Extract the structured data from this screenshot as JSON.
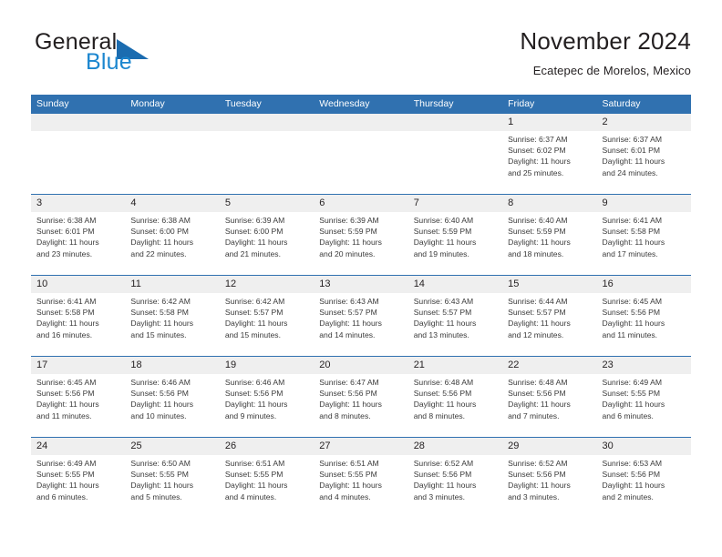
{
  "brand": {
    "general": "General",
    "blue": "Blue",
    "mark": "blue-triangle-logo"
  },
  "header": {
    "title": "November 2024",
    "subtitle": "Ecatepec de Morelos, Mexico"
  },
  "colors": {
    "header_blue": "#3071b0",
    "day_band_gray": "#efefef",
    "brand_blue": "#1b86cf",
    "text": "#231f20"
  },
  "weekdays": [
    "Sunday",
    "Monday",
    "Tuesday",
    "Wednesday",
    "Thursday",
    "Friday",
    "Saturday"
  ],
  "weeks": [
    [
      {
        "day": "",
        "sunrise": "",
        "sunset": "",
        "daylight1": "",
        "daylight2": ""
      },
      {
        "day": "",
        "sunrise": "",
        "sunset": "",
        "daylight1": "",
        "daylight2": ""
      },
      {
        "day": "",
        "sunrise": "",
        "sunset": "",
        "daylight1": "",
        "daylight2": ""
      },
      {
        "day": "",
        "sunrise": "",
        "sunset": "",
        "daylight1": "",
        "daylight2": ""
      },
      {
        "day": "",
        "sunrise": "",
        "sunset": "",
        "daylight1": "",
        "daylight2": ""
      },
      {
        "day": "1",
        "sunrise": "Sunrise: 6:37 AM",
        "sunset": "Sunset: 6:02 PM",
        "daylight1": "Daylight: 11 hours",
        "daylight2": "and 25 minutes."
      },
      {
        "day": "2",
        "sunrise": "Sunrise: 6:37 AM",
        "sunset": "Sunset: 6:01 PM",
        "daylight1": "Daylight: 11 hours",
        "daylight2": "and 24 minutes."
      }
    ],
    [
      {
        "day": "3",
        "sunrise": "Sunrise: 6:38 AM",
        "sunset": "Sunset: 6:01 PM",
        "daylight1": "Daylight: 11 hours",
        "daylight2": "and 23 minutes."
      },
      {
        "day": "4",
        "sunrise": "Sunrise: 6:38 AM",
        "sunset": "Sunset: 6:00 PM",
        "daylight1": "Daylight: 11 hours",
        "daylight2": "and 22 minutes."
      },
      {
        "day": "5",
        "sunrise": "Sunrise: 6:39 AM",
        "sunset": "Sunset: 6:00 PM",
        "daylight1": "Daylight: 11 hours",
        "daylight2": "and 21 minutes."
      },
      {
        "day": "6",
        "sunrise": "Sunrise: 6:39 AM",
        "sunset": "Sunset: 5:59 PM",
        "daylight1": "Daylight: 11 hours",
        "daylight2": "and 20 minutes."
      },
      {
        "day": "7",
        "sunrise": "Sunrise: 6:40 AM",
        "sunset": "Sunset: 5:59 PM",
        "daylight1": "Daylight: 11 hours",
        "daylight2": "and 19 minutes."
      },
      {
        "day": "8",
        "sunrise": "Sunrise: 6:40 AM",
        "sunset": "Sunset: 5:59 PM",
        "daylight1": "Daylight: 11 hours",
        "daylight2": "and 18 minutes."
      },
      {
        "day": "9",
        "sunrise": "Sunrise: 6:41 AM",
        "sunset": "Sunset: 5:58 PM",
        "daylight1": "Daylight: 11 hours",
        "daylight2": "and 17 minutes."
      }
    ],
    [
      {
        "day": "10",
        "sunrise": "Sunrise: 6:41 AM",
        "sunset": "Sunset: 5:58 PM",
        "daylight1": "Daylight: 11 hours",
        "daylight2": "and 16 minutes."
      },
      {
        "day": "11",
        "sunrise": "Sunrise: 6:42 AM",
        "sunset": "Sunset: 5:58 PM",
        "daylight1": "Daylight: 11 hours",
        "daylight2": "and 15 minutes."
      },
      {
        "day": "12",
        "sunrise": "Sunrise: 6:42 AM",
        "sunset": "Sunset: 5:57 PM",
        "daylight1": "Daylight: 11 hours",
        "daylight2": "and 15 minutes."
      },
      {
        "day": "13",
        "sunrise": "Sunrise: 6:43 AM",
        "sunset": "Sunset: 5:57 PM",
        "daylight1": "Daylight: 11 hours",
        "daylight2": "and 14 minutes."
      },
      {
        "day": "14",
        "sunrise": "Sunrise: 6:43 AM",
        "sunset": "Sunset: 5:57 PM",
        "daylight1": "Daylight: 11 hours",
        "daylight2": "and 13 minutes."
      },
      {
        "day": "15",
        "sunrise": "Sunrise: 6:44 AM",
        "sunset": "Sunset: 5:57 PM",
        "daylight1": "Daylight: 11 hours",
        "daylight2": "and 12 minutes."
      },
      {
        "day": "16",
        "sunrise": "Sunrise: 6:45 AM",
        "sunset": "Sunset: 5:56 PM",
        "daylight1": "Daylight: 11 hours",
        "daylight2": "and 11 minutes."
      }
    ],
    [
      {
        "day": "17",
        "sunrise": "Sunrise: 6:45 AM",
        "sunset": "Sunset: 5:56 PM",
        "daylight1": "Daylight: 11 hours",
        "daylight2": "and 11 minutes."
      },
      {
        "day": "18",
        "sunrise": "Sunrise: 6:46 AM",
        "sunset": "Sunset: 5:56 PM",
        "daylight1": "Daylight: 11 hours",
        "daylight2": "and 10 minutes."
      },
      {
        "day": "19",
        "sunrise": "Sunrise: 6:46 AM",
        "sunset": "Sunset: 5:56 PM",
        "daylight1": "Daylight: 11 hours",
        "daylight2": "and 9 minutes."
      },
      {
        "day": "20",
        "sunrise": "Sunrise: 6:47 AM",
        "sunset": "Sunset: 5:56 PM",
        "daylight1": "Daylight: 11 hours",
        "daylight2": "and 8 minutes."
      },
      {
        "day": "21",
        "sunrise": "Sunrise: 6:48 AM",
        "sunset": "Sunset: 5:56 PM",
        "daylight1": "Daylight: 11 hours",
        "daylight2": "and 8 minutes."
      },
      {
        "day": "22",
        "sunrise": "Sunrise: 6:48 AM",
        "sunset": "Sunset: 5:56 PM",
        "daylight1": "Daylight: 11 hours",
        "daylight2": "and 7 minutes."
      },
      {
        "day": "23",
        "sunrise": "Sunrise: 6:49 AM",
        "sunset": "Sunset: 5:55 PM",
        "daylight1": "Daylight: 11 hours",
        "daylight2": "and 6 minutes."
      }
    ],
    [
      {
        "day": "24",
        "sunrise": "Sunrise: 6:49 AM",
        "sunset": "Sunset: 5:55 PM",
        "daylight1": "Daylight: 11 hours",
        "daylight2": "and 6 minutes."
      },
      {
        "day": "25",
        "sunrise": "Sunrise: 6:50 AM",
        "sunset": "Sunset: 5:55 PM",
        "daylight1": "Daylight: 11 hours",
        "daylight2": "and 5 minutes."
      },
      {
        "day": "26",
        "sunrise": "Sunrise: 6:51 AM",
        "sunset": "Sunset: 5:55 PM",
        "daylight1": "Daylight: 11 hours",
        "daylight2": "and 4 minutes."
      },
      {
        "day": "27",
        "sunrise": "Sunrise: 6:51 AM",
        "sunset": "Sunset: 5:55 PM",
        "daylight1": "Daylight: 11 hours",
        "daylight2": "and 4 minutes."
      },
      {
        "day": "28",
        "sunrise": "Sunrise: 6:52 AM",
        "sunset": "Sunset: 5:56 PM",
        "daylight1": "Daylight: 11 hours",
        "daylight2": "and 3 minutes."
      },
      {
        "day": "29",
        "sunrise": "Sunrise: 6:52 AM",
        "sunset": "Sunset: 5:56 PM",
        "daylight1": "Daylight: 11 hours",
        "daylight2": "and 3 minutes."
      },
      {
        "day": "30",
        "sunrise": "Sunrise: 6:53 AM",
        "sunset": "Sunset: 5:56 PM",
        "daylight1": "Daylight: 11 hours",
        "daylight2": "and 2 minutes."
      }
    ]
  ]
}
